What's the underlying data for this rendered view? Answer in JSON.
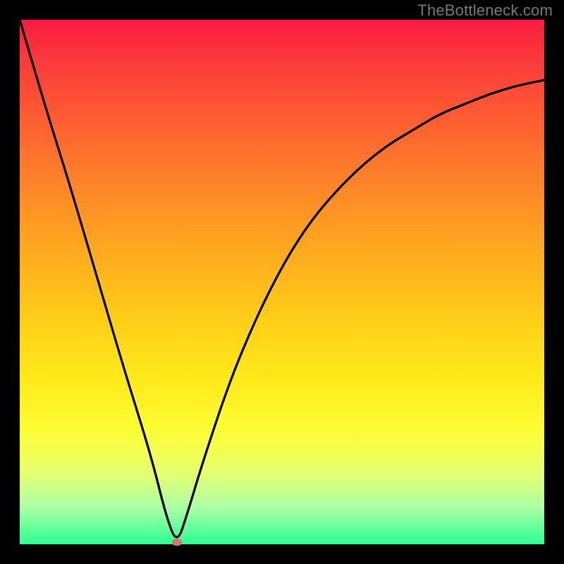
{
  "watermark": "TheBottleneck.com",
  "colors": {
    "frame_bg": "#000000",
    "gradient_top": "#fa1b40",
    "gradient_bottom": "#2bff93",
    "curve": "#000000",
    "marker": "#cf7a6c",
    "watermark": "#7a7a7a"
  },
  "chart_data": {
    "type": "line",
    "title": "",
    "xlabel": "",
    "ylabel": "",
    "xlim": [
      0,
      100
    ],
    "ylim": [
      0,
      100
    ],
    "marker_point": {
      "x": 30,
      "y": 0
    },
    "series": [
      {
        "name": "bottleneck-curve",
        "x": [
          0,
          5,
          10,
          15,
          20,
          25,
          28,
          30,
          32,
          35,
          40,
          45,
          50,
          55,
          60,
          65,
          70,
          75,
          80,
          85,
          90,
          95,
          100
        ],
        "y": [
          100,
          83,
          67,
          50,
          33,
          17,
          5,
          0,
          6,
          16,
          31,
          43,
          53,
          61,
          67,
          72,
          76,
          79,
          82,
          84,
          86,
          87.5,
          88.5
        ]
      }
    ],
    "notes": "V-shaped bottleneck curve with minimum near x≈30; background is a vertical gradient from red (top, high bottleneck) through orange/yellow to green (bottom, low bottleneck). No axis ticks or labels visible."
  }
}
